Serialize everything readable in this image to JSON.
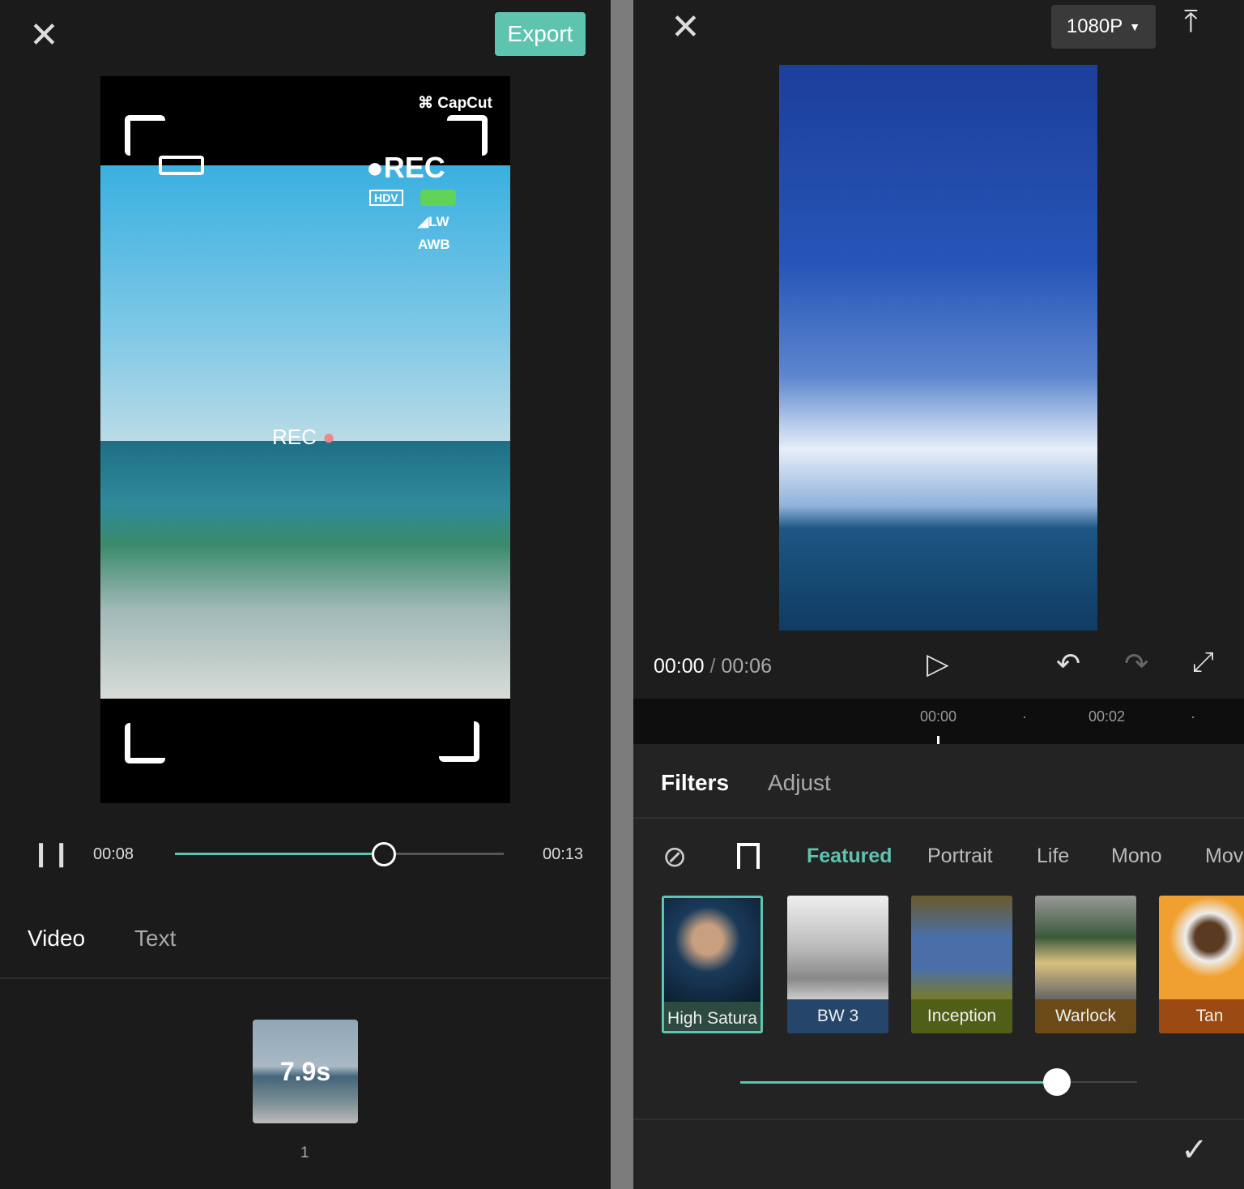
{
  "left": {
    "export_label": "Export",
    "overlay": {
      "brand": "CapCut",
      "rec_top": "REC",
      "hdv": "HDV",
      "lw": "LW",
      "awb": "AWB",
      "rec_mid": "REC"
    },
    "player": {
      "current_time": "00:08",
      "total_time": "00:13",
      "progress": 0.63
    },
    "tabs": [
      {
        "label": "Video",
        "active": true
      },
      {
        "label": "Text",
        "active": false
      }
    ],
    "clip": {
      "duration": "7.9s",
      "index": "1"
    }
  },
  "right": {
    "resolution": "1080P",
    "player": {
      "current_time": "00:00",
      "separator": "/",
      "total_time": "00:06"
    },
    "timeline_ticks": [
      "00:00",
      "00:02"
    ],
    "panel_tabs": [
      {
        "label": "Filters",
        "active": true
      },
      {
        "label": "Adjust",
        "active": false
      }
    ],
    "categories": [
      {
        "label": "Featured",
        "active": true
      },
      {
        "label": "Portrait"
      },
      {
        "label": "Life"
      },
      {
        "label": "Mono"
      },
      {
        "label": "Mov"
      }
    ],
    "filters": [
      {
        "label": "High Satura",
        "selected": true,
        "label_color": "#2c4a40"
      },
      {
        "label": "BW 3",
        "label_color": "#26456b"
      },
      {
        "label": "Inception",
        "label_color": "#4f5f17"
      },
      {
        "label": "Warlock",
        "label_color": "#6b4a17"
      },
      {
        "label": "Tan",
        "label_color": "#9a4a12"
      }
    ],
    "intensity": 0.8,
    "accent": "#5ec4b0"
  }
}
